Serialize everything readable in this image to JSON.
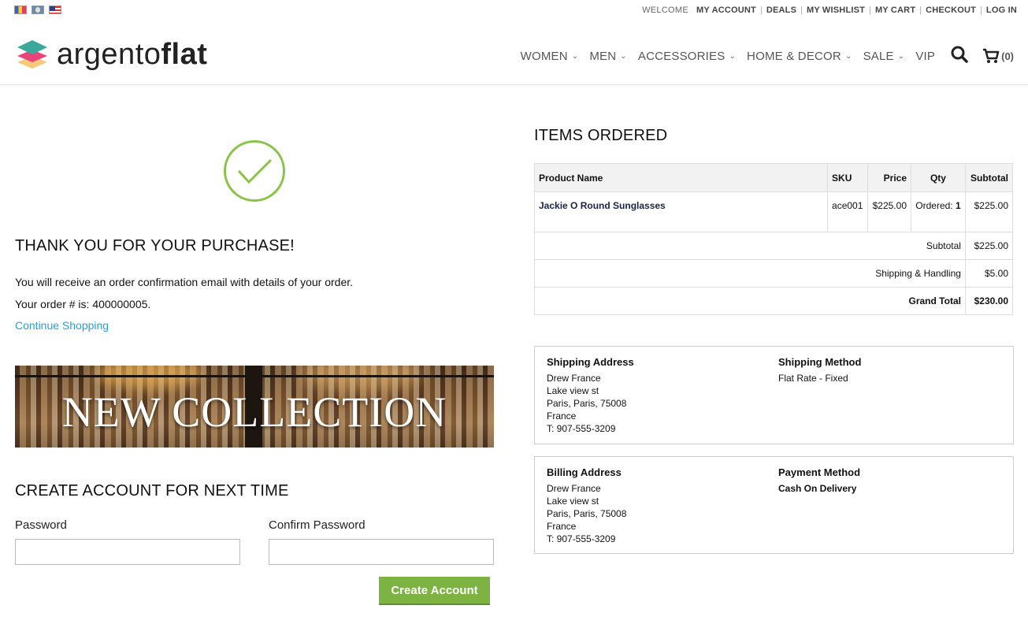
{
  "topbar": {
    "flags": [
      "flag-fr",
      "flag-de",
      "flag-en"
    ],
    "welcome": "WELCOME",
    "links": [
      "MY ACCOUNT",
      "DEALS",
      "MY WISHLIST",
      "MY CART",
      "CHECKOUT",
      "LOG IN"
    ]
  },
  "logo": {
    "text_light": "argento",
    "text_bold": "flat"
  },
  "nav": {
    "items": [
      "WOMEN",
      "MEN",
      "ACCESSORIES",
      "HOME & DECOR",
      "SALE"
    ],
    "vip": "VIP",
    "cart_count": "(0)"
  },
  "success": {
    "title": "THANK YOU FOR YOUR PURCHASE!",
    "confirmation": "You will receive an order confirmation email with details of your order.",
    "order_number": "Your order # is: 400000005.",
    "continue": "Continue Shopping"
  },
  "banner": {
    "text": "NEW COLLECTION"
  },
  "create_account": {
    "title": "CREATE ACCOUNT FOR NEXT TIME",
    "password_label": "Password",
    "confirm_label": "Confirm Password",
    "button": "Create Account"
  },
  "order": {
    "title": "ITEMS ORDERED",
    "headers": [
      "Product Name",
      "SKU",
      "Price",
      "Qty",
      "Subtotal"
    ],
    "items": [
      {
        "name": "Jackie O Round Sunglasses",
        "sku": "ace001",
        "price": "$225.00",
        "qty_label": "Ordered:",
        "qty": "1",
        "subtotal": "$225.00"
      }
    ],
    "totals": [
      {
        "label": "Subtotal",
        "value": "$225.00"
      },
      {
        "label": "Shipping & Handling",
        "value": "$5.00"
      },
      {
        "label": "Grand Total",
        "value": "$230.00"
      }
    ]
  },
  "shipping": {
    "address_title": "Shipping Address",
    "address": [
      "Drew France",
      "Lake view st",
      "Paris, Paris, 75008",
      "France",
      "T: 907-555-3209"
    ],
    "method_title": "Shipping Method",
    "method": "Flat Rate - Fixed"
  },
  "billing": {
    "address_title": "Billing Address",
    "address": [
      "Drew France",
      "Lake view st",
      "Paris, Paris, 75008",
      "France",
      "T: 907-555-3209"
    ],
    "method_title": "Payment Method",
    "method": "Cash On Delivery"
  },
  "colors": {
    "accent_green": "#7cb342",
    "link_blue": "#2a9fd6",
    "check_green": "#8bc34a"
  }
}
